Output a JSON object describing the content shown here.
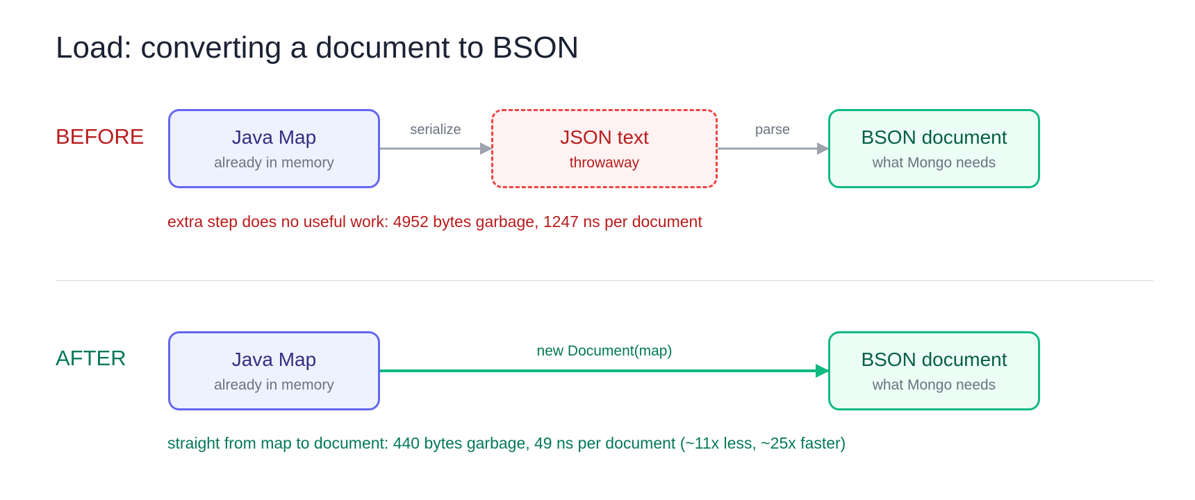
{
  "title": "Load: converting a document to BSON",
  "before": {
    "label": "BEFORE",
    "nodes": {
      "java": {
        "title": "Java Map",
        "sub": "already in memory"
      },
      "json": {
        "title": "JSON text",
        "sub": "throwaway"
      },
      "bson": {
        "title": "BSON document",
        "sub": "what Mongo needs"
      }
    },
    "edges": {
      "serialize": "serialize",
      "parse": "parse"
    },
    "note": "extra step does no useful work: 4952 bytes garbage, 1247 ns per document"
  },
  "after": {
    "label": "AFTER",
    "nodes": {
      "java": {
        "title": "Java Map",
        "sub": "already in memory"
      },
      "bson": {
        "title": "BSON document",
        "sub": "what Mongo needs"
      }
    },
    "edges": {
      "direct": "new Document(map)"
    },
    "note": "straight from map to document: 440 bytes garbage, 49 ns per document (~11x less, ~25x faster)"
  },
  "colors": {
    "arrow_gray": "#9ca3af",
    "arrow_green": "#10b981",
    "before_accent": "#b91c1c",
    "after_accent": "#047857"
  }
}
